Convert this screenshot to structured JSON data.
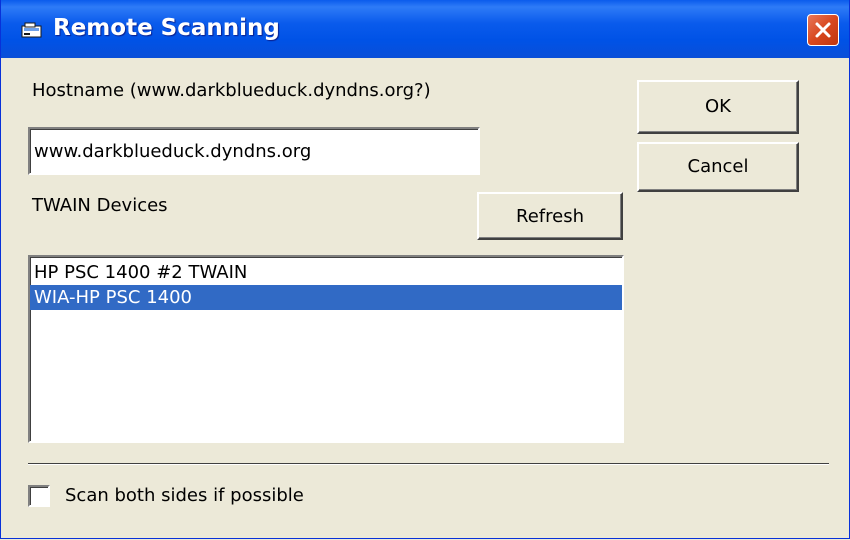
{
  "window": {
    "title": "Remote Scanning",
    "title_icon": "scanner-icon",
    "close_icon": "close-icon"
  },
  "hostname": {
    "label": "Hostname (www.darkblueduck.dyndns.org?)",
    "value": "www.darkblueduck.dyndns.org"
  },
  "buttons": {
    "ok": "OK",
    "cancel": "Cancel",
    "refresh": "Refresh"
  },
  "devices": {
    "label": "TWAIN Devices",
    "items": [
      {
        "label": "HP PSC 1400 #2 TWAIN",
        "selected": false
      },
      {
        "label": "WIA-HP PSC 1400",
        "selected": true
      }
    ]
  },
  "options": {
    "scan_both_sides_label": "Scan both sides if possible",
    "scan_both_sides_checked": false
  },
  "colors": {
    "titlebar": "#0A5BEC",
    "window_bg": "#ECE9D8",
    "selection": "#316AC5",
    "close_button": "#D8481F"
  }
}
